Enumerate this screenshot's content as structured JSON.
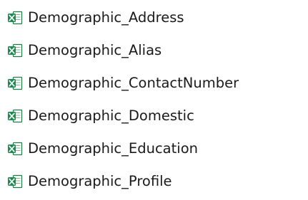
{
  "file_icon": "excel-workbook-icon",
  "files": [
    {
      "name": "Demographic_Address"
    },
    {
      "name": "Demographic_Alias"
    },
    {
      "name": "Demographic_ContactNumber"
    },
    {
      "name": "Demographic_Domestic"
    },
    {
      "name": "Demographic_Education"
    },
    {
      "name": "Demographic_Profile"
    }
  ]
}
